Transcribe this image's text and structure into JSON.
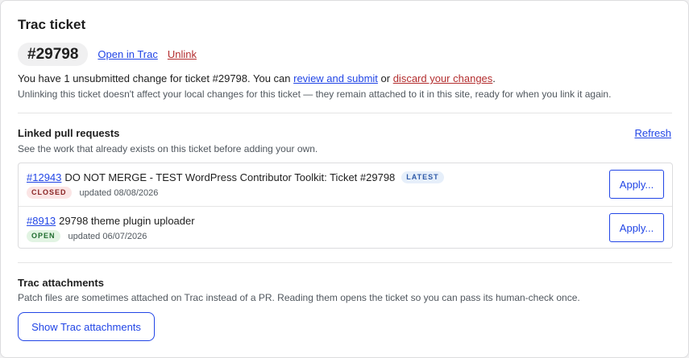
{
  "card": {
    "title": "Trac ticket",
    "ticket_number": "#29798",
    "open_in_trac": "Open in Trac",
    "unlink": "Unlink"
  },
  "notice": {
    "text_before": "You have 1 unsubmitted change for ticket #29798. You can ",
    "review_link": "review and submit",
    "text_or": " or ",
    "discard_link": "discard your changes",
    "text_after": ".",
    "unlink_note": "Unlinking this ticket doesn't affect your local changes for this ticket — they remain attached to it in this site, ready for when you link it again."
  },
  "linked_prs": {
    "title": "Linked pull requests",
    "refresh": "Refresh",
    "description": "See the work that already exists on this ticket before adding your own.",
    "items": [
      {
        "number": "#12943",
        "title": "DO NOT MERGE - TEST WordPress Contributor Toolkit: Ticket #29798",
        "latest_badge": "LATEST",
        "status": "CLOSED",
        "updated": "updated 08/08/2026",
        "apply": "Apply..."
      },
      {
        "number": "#8913",
        "title": "29798 theme plugin uploader",
        "status": "OPEN",
        "updated": "updated 06/07/2026",
        "apply": "Apply..."
      }
    ]
  },
  "attachments": {
    "title": "Trac attachments",
    "description": "Patch files are sometimes attached on Trac instead of a PR. Reading them opens the ticket so you can pass its human-check once.",
    "button": "Show Trac attachments"
  },
  "colors": {
    "link": "#2145e6",
    "danger_link": "#b32d2e",
    "latest_badge_bg": "#e6effa",
    "closed_badge_bg": "#fbe5e5",
    "open_badge_bg": "#e2f4e3"
  }
}
